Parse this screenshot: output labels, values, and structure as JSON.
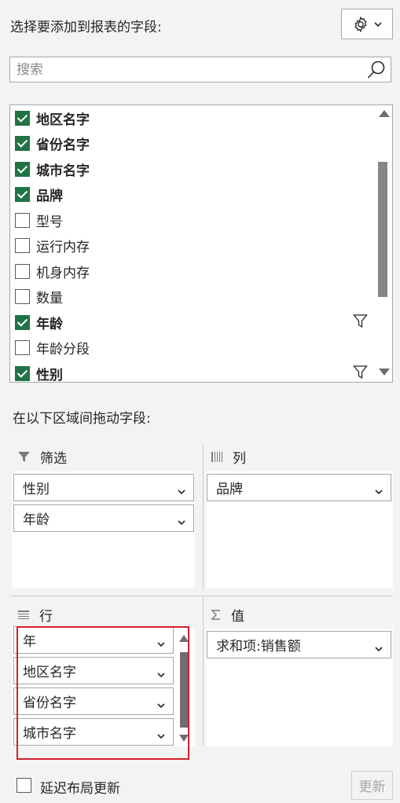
{
  "header": {
    "title": "选择要添加到报表的字段:",
    "settings_icon": "gear-icon"
  },
  "search": {
    "placeholder": "搜索",
    "icon": "search-icon"
  },
  "fields": [
    {
      "label": "地区名字",
      "checked": true,
      "filter": false
    },
    {
      "label": "省份名字",
      "checked": true,
      "filter": false
    },
    {
      "label": "城市名字",
      "checked": true,
      "filter": false
    },
    {
      "label": "品牌",
      "checked": true,
      "filter": false
    },
    {
      "label": "型号",
      "checked": false,
      "filter": false
    },
    {
      "label": "运行内存",
      "checked": false,
      "filter": false
    },
    {
      "label": "机身内存",
      "checked": false,
      "filter": false
    },
    {
      "label": "数量",
      "checked": false,
      "filter": false
    },
    {
      "label": "年龄",
      "checked": true,
      "filter": true
    },
    {
      "label": "年龄分段",
      "checked": false,
      "filter": false
    },
    {
      "label": "性别",
      "checked": true,
      "filter": true
    }
  ],
  "drag_title": "在以下区域间拖动字段:",
  "areas": {
    "filters": {
      "title": "筛选",
      "icon": "filter-icon",
      "items": [
        "性别",
        "年龄"
      ]
    },
    "columns": {
      "title": "列",
      "icon": "columns-icon",
      "items": [
        "品牌"
      ]
    },
    "rows": {
      "title": "行",
      "icon": "rows-icon",
      "items": [
        "年",
        "地区名字",
        "省份名字",
        "城市名字"
      ]
    },
    "values": {
      "title": "值",
      "icon": "sigma-icon",
      "items": [
        "求和项:销售额"
      ]
    }
  },
  "footer": {
    "defer_label": "延迟布局更新",
    "defer_checked": false,
    "update_label": "更新"
  },
  "colors": {
    "checkbox_green": "#217346",
    "highlight_red": "#d4202a"
  }
}
